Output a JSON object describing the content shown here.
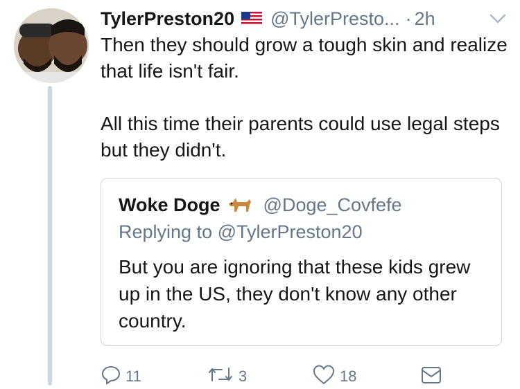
{
  "tweet": {
    "author_name": "TylerPreston20",
    "handle": "@TylerPresto...",
    "separator": "·",
    "time": "2h",
    "text": "Then they should grow a tough skin and realize that life isn't fair.\n\nAll this time their parents could use legal steps but they didn't."
  },
  "quoted_tweet": {
    "author_name": "Woke Doge",
    "handle": "@Doge_Covfefe",
    "reply_context": "Replying to @TylerPreston20",
    "text": "But you are ignoring that these kids grew up in the US, they don't know any other country."
  },
  "actions": {
    "reply_count": "11",
    "retweet_count": "3",
    "like_count": "18"
  },
  "icons": {
    "flag": "us-flag-icon",
    "dog": "dog-emoji-icon",
    "reply": "reply-icon",
    "retweet": "retweet-icon",
    "like": "heart-icon",
    "message": "envelope-icon",
    "menu": "chevron-down-icon"
  },
  "colors": {
    "text": "#14171a",
    "secondary": "#657786",
    "border": "#ccd6dd"
  }
}
